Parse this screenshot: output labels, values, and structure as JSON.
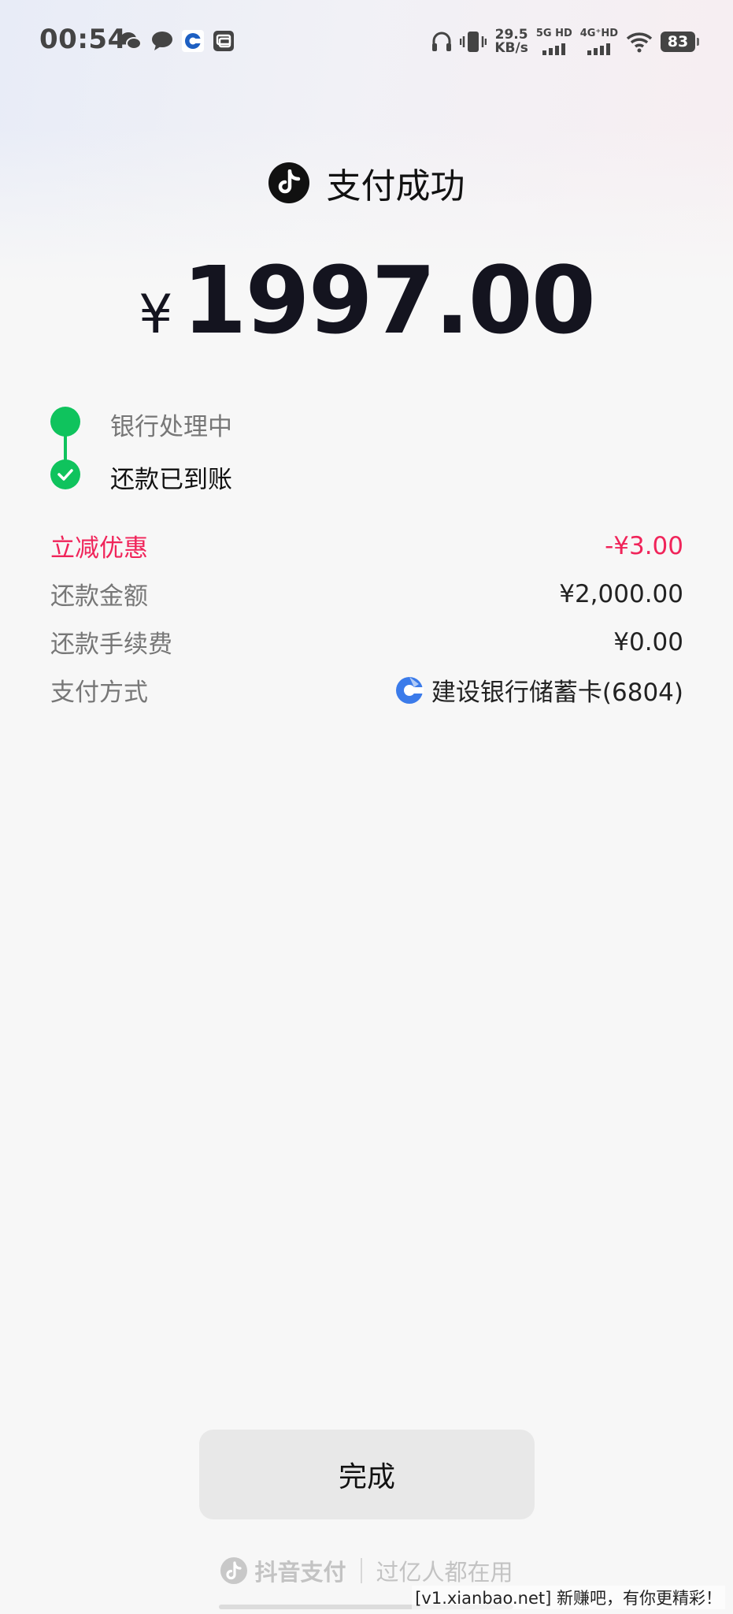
{
  "status_bar": {
    "time": "00:54",
    "notif_icons": [
      "wechat-icon",
      "message-icon",
      "ccb-bank-icon",
      "gallery-icon"
    ],
    "speed_value": "29.5",
    "speed_unit": "KB/s",
    "sim1_label": "5G HD",
    "sim2_label": "4G⁺HD",
    "battery": "83"
  },
  "header": {
    "title": "支付成功",
    "logo": "douyin-icon"
  },
  "amount": {
    "currency": "¥",
    "value": "1997.00"
  },
  "timeline": [
    {
      "label": "银行处理中",
      "state": "done"
    },
    {
      "label": "还款已到账",
      "state": "checked"
    }
  ],
  "details": [
    {
      "key": "立减优惠",
      "value": "-¥3.00",
      "highlight": true
    },
    {
      "key": "还款金额",
      "value": "¥2,000.00"
    },
    {
      "key": "还款手续费",
      "value": "¥0.00"
    },
    {
      "key": "支付方式",
      "value": "建设银行储蓄卡(6804)",
      "icon": "ccb-bank-icon"
    }
  ],
  "done_button": "完成",
  "footer": {
    "brand": "抖音支付",
    "slogan": "过亿人都在用"
  },
  "watermark": "[v1.xianbao.net] 新赚吧，有你更精彩！",
  "colors": {
    "success_green": "#0fc35d",
    "discount_red": "#f0245a",
    "ccb_blue": "#2f6fe0"
  }
}
